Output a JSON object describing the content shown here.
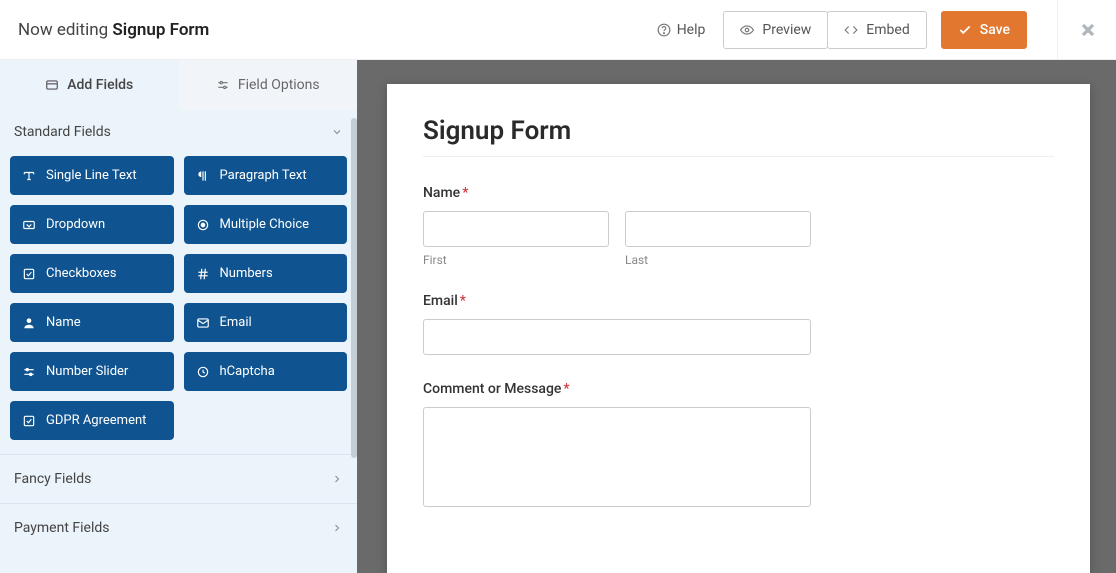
{
  "topbar": {
    "editing_prefix": "Now editing ",
    "form_name": "Signup Form",
    "help": "Help",
    "preview": "Preview",
    "embed": "Embed",
    "save": "Save"
  },
  "sidebar": {
    "tabs": {
      "add_fields": "Add Fields",
      "field_options": "Field Options"
    },
    "sections": {
      "standard": "Standard Fields",
      "fancy": "Fancy Fields",
      "payment": "Payment Fields"
    },
    "standard_fields": [
      {
        "id": "single-line-text",
        "label": "Single Line Text",
        "icon": "text-icon"
      },
      {
        "id": "paragraph-text",
        "label": "Paragraph Text",
        "icon": "paragraph-icon"
      },
      {
        "id": "dropdown",
        "label": "Dropdown",
        "icon": "dropdown-icon"
      },
      {
        "id": "multiple-choice",
        "label": "Multiple Choice",
        "icon": "radio-icon"
      },
      {
        "id": "checkboxes",
        "label": "Checkboxes",
        "icon": "checkbox-icon"
      },
      {
        "id": "numbers",
        "label": "Numbers",
        "icon": "hash-icon"
      },
      {
        "id": "name",
        "label": "Name",
        "icon": "user-icon"
      },
      {
        "id": "email",
        "label": "Email",
        "icon": "mail-icon"
      },
      {
        "id": "number-slider",
        "label": "Number Slider",
        "icon": "slider-icon"
      },
      {
        "id": "hcaptcha",
        "label": "hCaptcha",
        "icon": "captcha-icon"
      },
      {
        "id": "gdpr",
        "label": "GDPR Agreement",
        "icon": "check-icon"
      }
    ]
  },
  "form": {
    "title": "Signup Form",
    "fields": {
      "name": {
        "label": "Name",
        "required": true,
        "first_sublabel": "First",
        "last_sublabel": "Last"
      },
      "email": {
        "label": "Email",
        "required": true
      },
      "comment": {
        "label": "Comment or Message",
        "required": true
      }
    }
  }
}
